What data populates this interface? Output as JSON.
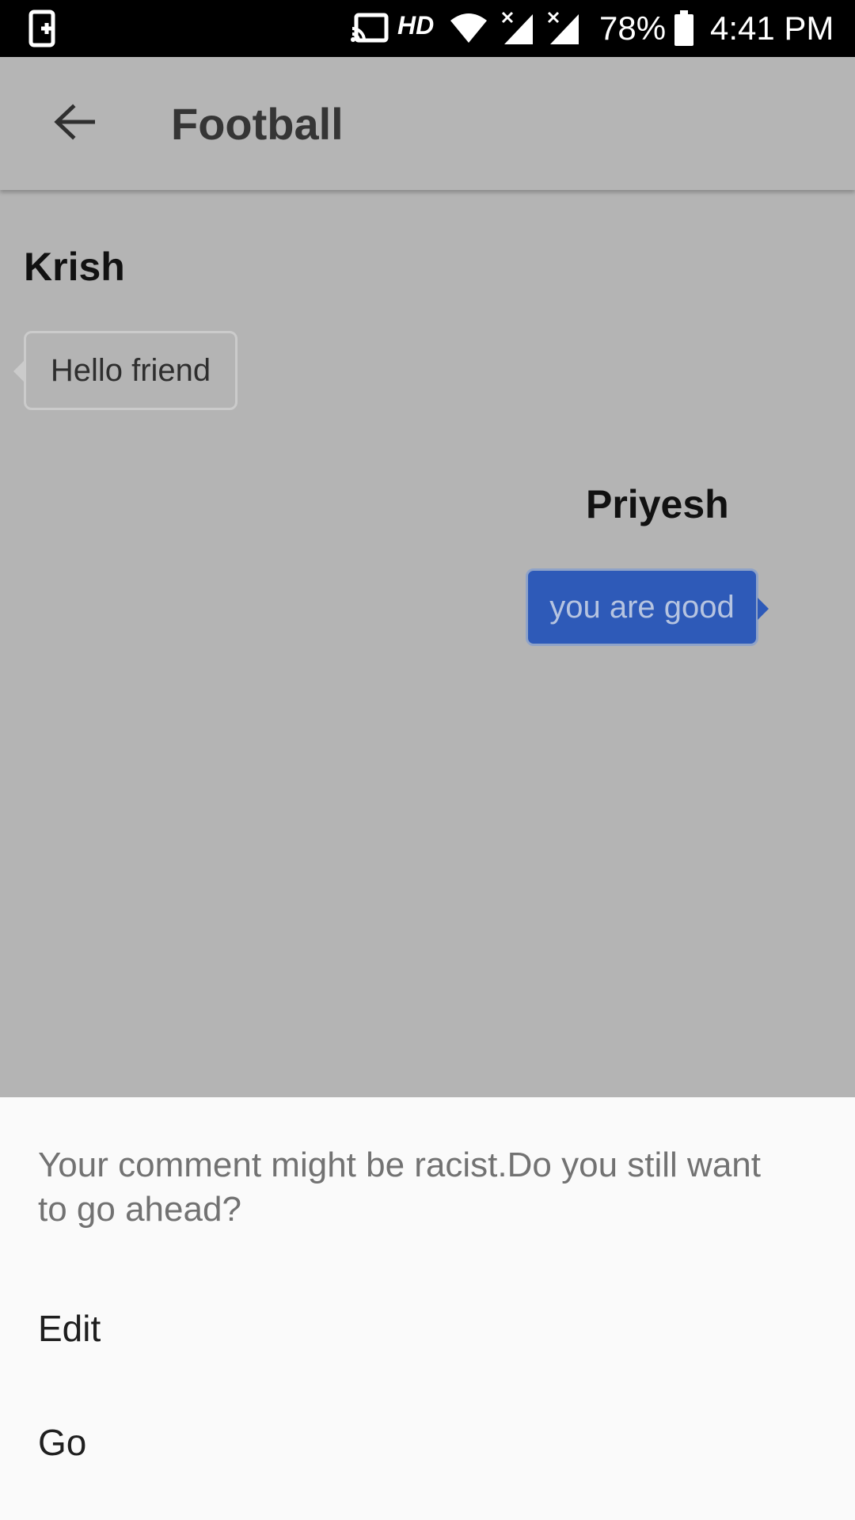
{
  "status_bar": {
    "network_label": "HD",
    "battery_percent": "78%",
    "time": "4:41 PM",
    "icons": [
      "screen-mirror-icon",
      "cast-icon",
      "wifi-icon",
      "signal-no-service-icon",
      "signal-no-service-icon",
      "battery-icon"
    ]
  },
  "app_bar": {
    "title": "Football",
    "back_icon": "arrow-back-icon"
  },
  "chat": {
    "messages": [
      {
        "sender": "Krish",
        "text": "Hello friend",
        "direction": "incoming"
      },
      {
        "sender": "Priyesh",
        "text": "you are good",
        "direction": "outgoing"
      }
    ]
  },
  "bottom_sheet": {
    "message": "Your comment might be racist.Do you still want to go ahead?",
    "options": [
      {
        "label": "Edit"
      },
      {
        "label": "Go"
      }
    ]
  },
  "colors": {
    "status_bar_bg": "#000000",
    "dim_overlay_bg": "#b4b4b4",
    "outgoing_bubble": "#2e5ab8",
    "sheet_bg": "#fafafa",
    "sheet_message_text": "#727272"
  }
}
